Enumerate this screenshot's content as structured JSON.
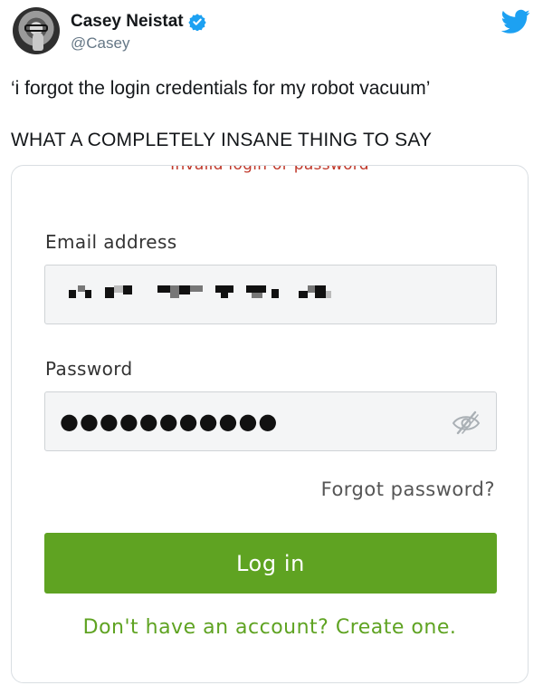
{
  "tweet": {
    "author_name": "Casey Neistat",
    "author_handle": "@Casey",
    "line1": "‘i forgot the login credentials for my robot vacuum’",
    "line2": "WHAT A COMPLETELY INSANE THING TO SAY"
  },
  "login_form": {
    "error_text": "Invalid login or password",
    "email_label": "Email address",
    "password_label": "Password",
    "password_mask": "●●●●●●●●●●●",
    "forgot_link": "Forgot password?",
    "login_button": "Log in",
    "create_link": "Don't have an account? Create one."
  },
  "colors": {
    "twitter_blue": "#1da1f2",
    "accent_green": "#5fa322",
    "error_red": "#c0392b"
  },
  "icons": [
    "verified-badge-icon",
    "twitter-bird-icon",
    "eye-slash-icon"
  ]
}
